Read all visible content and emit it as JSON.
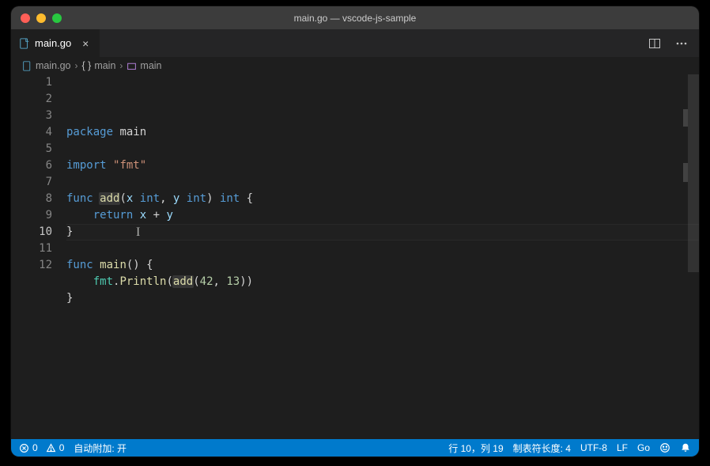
{
  "window": {
    "title": "main.go — vscode-js-sample"
  },
  "tab": {
    "filename": "main.go"
  },
  "breadcrumbs": {
    "file": "main.go",
    "namespace": "main",
    "func": "main"
  },
  "code": {
    "active_line": 10,
    "lines": [
      [
        {
          "t": "package ",
          "c": "kw"
        },
        {
          "t": "main",
          "c": ""
        }
      ],
      [
        {
          "t": "",
          "c": ""
        }
      ],
      [
        {
          "t": "import ",
          "c": "kw"
        },
        {
          "t": "\"fmt\"",
          "c": "str"
        }
      ],
      [
        {
          "t": "",
          "c": ""
        }
      ],
      [
        {
          "t": "func ",
          "c": "kw"
        },
        {
          "t": "add",
          "c": "fn hl-ref"
        },
        {
          "t": "(",
          "c": ""
        },
        {
          "t": "x",
          "c": "id"
        },
        {
          "t": " ",
          "c": ""
        },
        {
          "t": "int",
          "c": "typ"
        },
        {
          "t": ", ",
          "c": ""
        },
        {
          "t": "y",
          "c": "id"
        },
        {
          "t": " ",
          "c": ""
        },
        {
          "t": "int",
          "c": "typ"
        },
        {
          "t": ") ",
          "c": ""
        },
        {
          "t": "int",
          "c": "typ"
        },
        {
          "t": " {",
          "c": ""
        }
      ],
      [
        {
          "t": "    ",
          "c": ""
        },
        {
          "t": "return",
          "c": "kw"
        },
        {
          "t": " ",
          "c": ""
        },
        {
          "t": "x",
          "c": "id"
        },
        {
          "t": " + ",
          "c": ""
        },
        {
          "t": "y",
          "c": "id"
        }
      ],
      [
        {
          "t": "}",
          "c": ""
        }
      ],
      [
        {
          "t": "",
          "c": ""
        }
      ],
      [
        {
          "t": "func ",
          "c": "kw"
        },
        {
          "t": "main",
          "c": "fn"
        },
        {
          "t": "() {",
          "c": ""
        }
      ],
      [
        {
          "t": "    ",
          "c": ""
        },
        {
          "t": "fmt",
          "c": "pkg"
        },
        {
          "t": ".",
          "c": ""
        },
        {
          "t": "Println",
          "c": "fn"
        },
        {
          "t": "(",
          "c": ""
        },
        {
          "t": "add",
          "c": "fn hl-ref"
        },
        {
          "t": "(",
          "c": ""
        },
        {
          "t": "42",
          "c": "num"
        },
        {
          "t": ", ",
          "c": ""
        },
        {
          "t": "13",
          "c": "num"
        },
        {
          "t": "))",
          "c": ""
        }
      ],
      [
        {
          "t": "}",
          "c": ""
        }
      ],
      [
        {
          "t": "",
          "c": ""
        }
      ]
    ]
  },
  "status": {
    "errors": "0",
    "warnings": "0",
    "auto_attach": "自动附加: 开",
    "line_col": "行 10，列 19",
    "tab_size": "制表符长度: 4",
    "encoding": "UTF-8",
    "eol": "LF",
    "lang": "Go"
  }
}
